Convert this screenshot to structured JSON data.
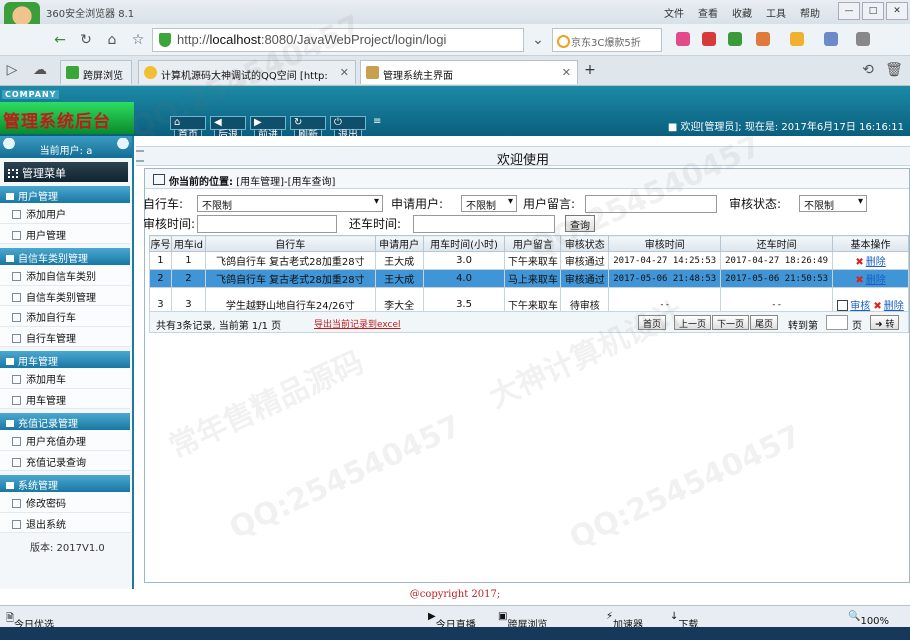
{
  "browser": {
    "app_title": "360安全浏览器 8.1",
    "menu": [
      "文件",
      "查看",
      "收藏",
      "工具",
      "帮助"
    ],
    "url_prefix": "http://",
    "url_host": "localhost",
    "url_rest": ":8080/JavaWebProject/login/logi",
    "search_text": "京东3C爆款5折",
    "tabs": [
      {
        "label": "跨屏浏览"
      },
      {
        "label": "计算机源码大神调试的QQ空间 [http:"
      },
      {
        "label": "管理系统主界面"
      }
    ]
  },
  "header": {
    "company": "COMPANY",
    "system_title": "管理系统后台",
    "nav": [
      "首页",
      "后退",
      "前进",
      "刷新",
      "退出"
    ],
    "welcome": "欢迎[管理员]; 现在是: 2017年6月17日 16:16:11"
  },
  "sidebar": {
    "current_user_label": "当前用户: a",
    "main_menu": "管理菜单",
    "groups": [
      {
        "title": "用户管理",
        "items": [
          "添加用户",
          "用户管理"
        ]
      },
      {
        "title": "自信车类别管理",
        "items": [
          "添加自信车类别",
          "自信车类别管理",
          "添加自行车",
          "自行车管理"
        ]
      },
      {
        "title": "用车管理",
        "items": [
          "添加用车",
          "用车管理"
        ]
      },
      {
        "title": "充值记录管理",
        "items": [
          "用户充值办理",
          "充值记录查询"
        ]
      },
      {
        "title": "系统管理",
        "items": [
          "修改密码",
          "退出系统"
        ]
      }
    ],
    "version": "版本: 2017V1.0"
  },
  "main": {
    "welcome_text": "欢迎使用",
    "location_label": "你当前的位置:",
    "location_path": "[用车管理]-[用车查询]",
    "filters": {
      "bike_label": "自行车:",
      "bike_value": "不限制",
      "user_label": "申请用户:",
      "user_value": "不限制",
      "message_label": "用户留言:",
      "status_label": "审核状态:",
      "status_value": "不限制",
      "audit_time_label": "审核时间:",
      "return_time_label": "还车时间:",
      "query_button": "查询"
    },
    "table": {
      "headers": [
        "序号",
        "用车id",
        "自行车",
        "申请用户",
        "用车时间(小时)",
        "用户留言",
        "审核状态",
        "审核时间",
        "还车时间",
        "基本操作"
      ],
      "rows": [
        {
          "no": "1",
          "id": "1",
          "bike": "飞鸽自行车 复古老式28加重28寸",
          "user": "王大成",
          "hours": "3.0",
          "msg": "下午来取车",
          "status": "审核通过",
          "audit_time": "2017-04-27 14:25:53",
          "return_time": "2017-04-27 18:26:49",
          "op_delete": "删除"
        },
        {
          "no": "2",
          "id": "2",
          "bike": "飞鸽自行车 复古老式28加重28寸",
          "user": "王大成",
          "hours": "4.0",
          "msg": "马上来取车",
          "status": "审核通过",
          "audit_time": "2017-05-06 21:48:53",
          "return_time": "2017-05-06 21:50:53",
          "op_delete": "删除"
        },
        {
          "no": "3",
          "id": "3",
          "bike": "学生越野山地自行车24/26寸",
          "user": "李大全",
          "hours": "3.5",
          "msg": "下午来取车",
          "status": "待审核",
          "audit_time": "--",
          "return_time": "--",
          "op_audit": "审核",
          "op_delete": "删除"
        }
      ]
    },
    "pager": {
      "summary": "共有3条记录, 当前第 1/1 页",
      "export": "导出当前记录到excel",
      "first": "首页",
      "prev": "上一页",
      "next": "下一页",
      "last": "尾页",
      "goto_label": "转到第",
      "page_unit": "页",
      "go": "转"
    }
  },
  "footer": {
    "copyright": "@copyright 2017;"
  },
  "statusbar": {
    "left": "今日优选",
    "items": [
      "今日直播",
      "跨屏浏览",
      "加速器",
      "下载"
    ],
    "zoom": "100%"
  },
  "watermarks": [
    "QQ:254540457",
    "大神计算机设计",
    "常年售精品源码"
  ]
}
